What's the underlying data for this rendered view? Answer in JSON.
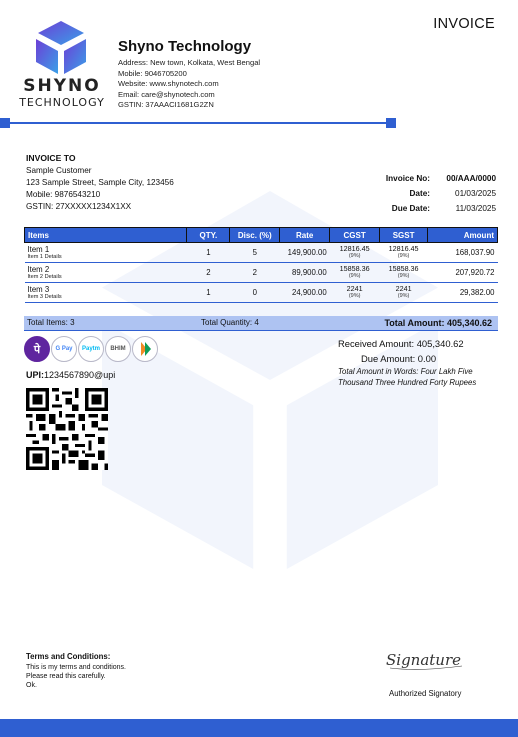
{
  "invoice_title": "INVOICE",
  "logo": {
    "name": "SHYNO",
    "sub": "TECHNOLOGY"
  },
  "company": {
    "name": "Shyno Technology",
    "address": "Address: New town, Kolkata, West Bengal",
    "mobile": "Mobile: 9046705200",
    "website": "Website: www.shynotech.com",
    "email": "Email: care@shynotech.com",
    "gstin": "GSTIN: 37AAACI1681G2ZN"
  },
  "bill_to": {
    "heading": "INVOICE TO",
    "name": "Sample Customer",
    "address": "123 Sample Street, Sample City, 123456",
    "mobile": "Mobile: 9876543210",
    "gstin": "GSTIN: 27XXXXX1234X1XX"
  },
  "meta": {
    "invoice_no_label": "Invoice No:",
    "invoice_no": "00/AAA/0000",
    "date_label": "Date:",
    "date": "01/03/2025",
    "due_date_label": "Due Date:",
    "due_date": "11/03/2025"
  },
  "table": {
    "headers": [
      "Items",
      "QTY.",
      "Disc. (%)",
      "Rate",
      "CGST",
      "SGST",
      "Amount"
    ],
    "rows": [
      {
        "item": "Item 1",
        "details": "Item 1 Details",
        "qty": "1",
        "disc": "5",
        "rate": "149,900.00",
        "cgst": "12816.45",
        "cgst_pct": "(9%)",
        "sgst": "12816.45",
        "sgst_pct": "(9%)",
        "amount": "168,037.90"
      },
      {
        "item": "Item 2",
        "details": "Item 2 Details",
        "qty": "2",
        "disc": "2",
        "rate": "89,900.00",
        "cgst": "15858.36",
        "cgst_pct": "(9%)",
        "sgst": "15858.36",
        "sgst_pct": "(9%)",
        "amount": "207,920.72"
      },
      {
        "item": "Item 3",
        "details": "Item 3 Details",
        "qty": "1",
        "disc": "0",
        "rate": "24,900.00",
        "cgst": "2241",
        "cgst_pct": "(9%)",
        "sgst": "2241",
        "sgst_pct": "(9%)",
        "amount": "29,382.00"
      }
    ]
  },
  "totals": {
    "total_items": "Total Items: 3",
    "total_quantity": "Total Quantity: 4",
    "total_amount": "Total Amount: 405,340.62"
  },
  "payment": {
    "icons": [
      "phonepe-icon",
      "gpay-icon",
      "paytm-icon",
      "bhim-icon",
      "upi-icon"
    ],
    "icon_labels": [
      "पे",
      "G Pay",
      "Paytm",
      "BHIM",
      ""
    ],
    "upi_label": "UPI:",
    "upi_id": "1234567890@upi"
  },
  "summary": {
    "received": "Received Amount: 405,340.62",
    "due": "Due Amount: 0.00",
    "words": "Total Amount in Words: Four Lakh Five Thousand Three Hundred Forty Rupees"
  },
  "terms": {
    "title": "Terms and Conditions:",
    "lines": [
      "This is my terms and conditions.",
      "Please read this carefully.",
      "Ok."
    ]
  },
  "signature": {
    "script": "Signature",
    "label": "Authorized Signatory"
  },
  "colors": {
    "accent": "#2f5fd1",
    "totals_bar": "#aec3f2"
  }
}
